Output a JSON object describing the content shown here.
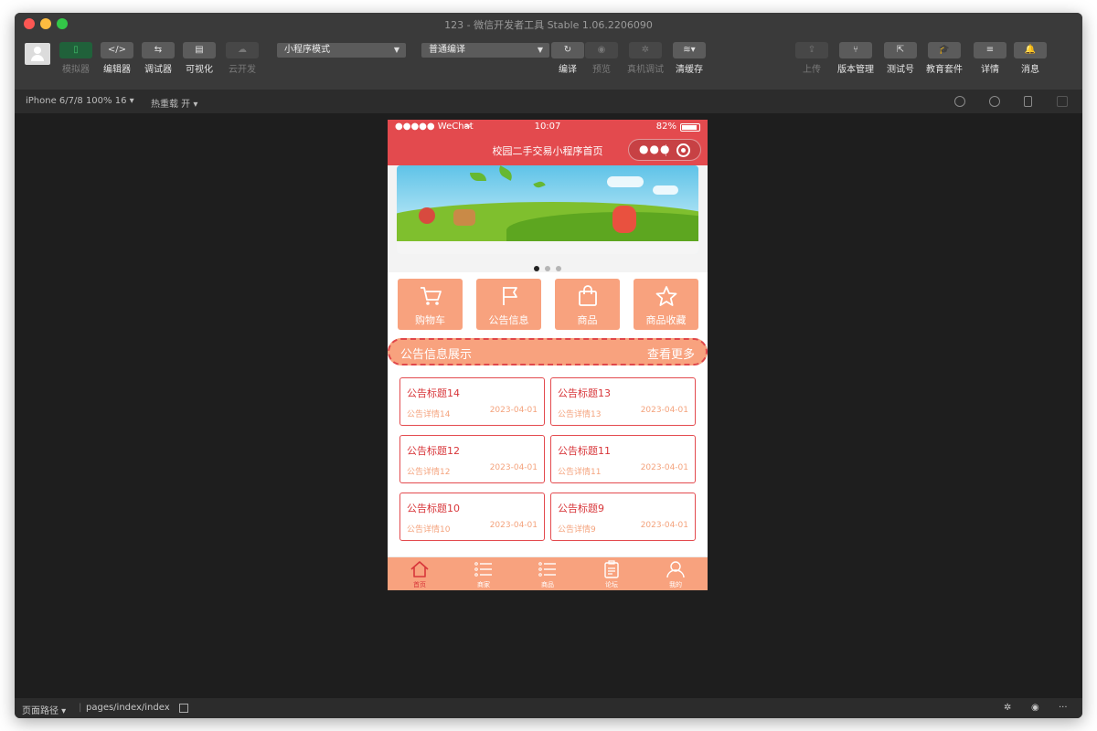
{
  "window": {
    "title": "123 - 微信开发者工具 Stable 1.06.2206090"
  },
  "toolbar": {
    "left_tools": [
      {
        "label": "模拟器",
        "glyph": "▯"
      },
      {
        "label": "编辑器",
        "glyph": "</>"
      },
      {
        "label": "调试器",
        "glyph": "⇆"
      },
      {
        "label": "可视化",
        "glyph": "▤"
      },
      {
        "label": "云开发",
        "glyph": "☁"
      }
    ],
    "mode_select": "小程序模式",
    "compile_select": "普通编译",
    "mid_tools": [
      {
        "label": "编译",
        "glyph": "↻"
      },
      {
        "label": "预览",
        "glyph": "◉"
      },
      {
        "label": "真机调试",
        "glyph": "✲"
      },
      {
        "label": "清缓存",
        "glyph": "≋▾"
      }
    ],
    "right_tools": [
      {
        "label": "上传",
        "glyph": "⇪"
      },
      {
        "label": "版本管理",
        "glyph": "⑂"
      },
      {
        "label": "测试号",
        "glyph": "⇱"
      },
      {
        "label": "教育套件",
        "glyph": "🎓"
      },
      {
        "label": "详情",
        "glyph": "≡"
      },
      {
        "label": "消息",
        "glyph": "🔔"
      }
    ]
  },
  "subbar": {
    "device": "iPhone 6/7/8 100% 16 ▾",
    "hot_reload": "热重载 开 ▾"
  },
  "statusbar": {
    "path_label": "页面路径 ▾",
    "path": "pages/index/index",
    "more": "···"
  },
  "phone": {
    "status": {
      "carrier": "●●●●● WeChat",
      "wifi": "≈",
      "time": "10:07",
      "battery": "82%"
    },
    "header_title": "校园二手交易小程序首页",
    "capsule_dots": "●●●",
    "banner_page": 1,
    "banner_count": 3,
    "menu": [
      {
        "label": "购物车",
        "icon": "cart-icon"
      },
      {
        "label": "公告信息",
        "icon": "flag-icon"
      },
      {
        "label": "商品",
        "icon": "bag-icon"
      },
      {
        "label": "商品收藏",
        "icon": "star-icon"
      }
    ],
    "notice_bar": {
      "title": "公告信息展示",
      "more": "查看更多"
    },
    "notices": [
      {
        "title": "公告标题14",
        "detail": "公告详情14",
        "date": "2023-04-01"
      },
      {
        "title": "公告标题13",
        "detail": "公告详情13",
        "date": "2023-04-01"
      },
      {
        "title": "公告标题12",
        "detail": "公告详情12",
        "date": "2023-04-01"
      },
      {
        "title": "公告标题11",
        "detail": "公告详情11",
        "date": "2023-04-01"
      },
      {
        "title": "公告标题10",
        "detail": "公告详情10",
        "date": "2023-04-01"
      },
      {
        "title": "公告标题9",
        "detail": "公告详情9",
        "date": "2023-04-01"
      }
    ],
    "tabbar": [
      {
        "label": "首页",
        "icon": "home-icon",
        "active": true
      },
      {
        "label": "商家",
        "icon": "list-icon",
        "active": false
      },
      {
        "label": "商品",
        "icon": "list-icon",
        "active": false
      },
      {
        "label": "论坛",
        "icon": "clipboard-icon",
        "active": false
      },
      {
        "label": "我的",
        "icon": "user-icon",
        "active": false
      }
    ]
  },
  "colors": {
    "brand_red": "#e34a4e",
    "peach": "#f8a27e",
    "ide_bg": "#1e1e1e",
    "toolbar_bg": "#3a3a3a"
  }
}
